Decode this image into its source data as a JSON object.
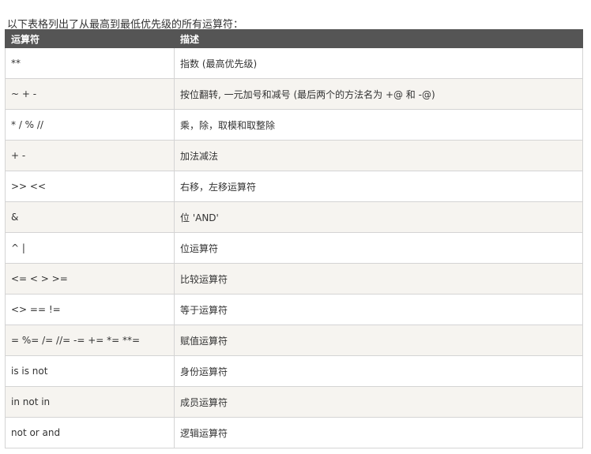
{
  "intro_text": "以下表格列出了从最高到最低优先级的所有运算符：",
  "table": {
    "headers": [
      "运算符",
      "描述"
    ],
    "rows": [
      {
        "operator": "**",
        "description": "指数 (最高优先级)"
      },
      {
        "operator": "~ + -",
        "description": "按位翻转, 一元加号和减号 (最后两个的方法名为 +@ 和 -@)"
      },
      {
        "operator": "* / % //",
        "description": "乘，除，取模和取整除"
      },
      {
        "operator": "+ -",
        "description": "加法减法"
      },
      {
        "operator": ">> <<",
        "description": "右移，左移运算符"
      },
      {
        "operator": "&",
        "description": "位 'AND'"
      },
      {
        "operator": "^ |",
        "description": "位运算符"
      },
      {
        "operator": "<= < > >=",
        "description": "比较运算符"
      },
      {
        "operator": "<> == !=",
        "description": "等于运算符"
      },
      {
        "operator": "= %= /= //= -= += *= **=",
        "description": "赋值运算符"
      },
      {
        "operator": "is is not",
        "description": "身份运算符"
      },
      {
        "operator": "in not in",
        "description": "成员运算符"
      },
      {
        "operator": "not or and",
        "description": "逻辑运算符"
      }
    ]
  },
  "colors": {
    "header_bg": "#555555",
    "header_text": "#ffffff",
    "stripe_bg": "#f6f4f0",
    "border": "#d4d4d4",
    "text": "#333333"
  }
}
